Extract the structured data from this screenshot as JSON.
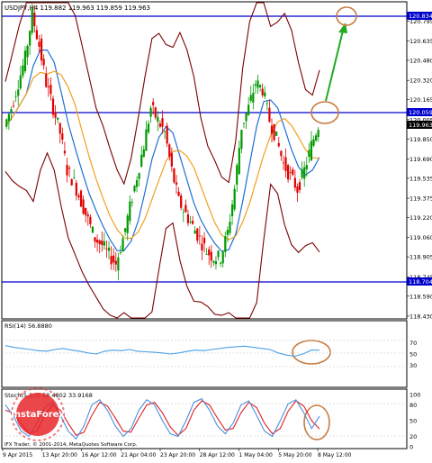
{
  "header": {
    "symbol_line": "USDJPY,H4  119.882 119.963 119.859 119.963"
  },
  "colors": {
    "background": "#ffffff",
    "frame": "#000000",
    "bull_candle": "#009900",
    "bear_candle": "#e00000",
    "bollinger": "#7a0000",
    "ma_blue": "#1f6fd6",
    "ma_orange": "#f0a020",
    "level_line": "#0000cc",
    "arrow": "#22aa22",
    "circle": "#c87a40",
    "rsi_line": "#4aa0e6",
    "stoch_main": "#4a8fe0",
    "stoch_signal": "#e02020",
    "current_price_bg": "#000000",
    "level_price_bg": "#0000cc"
  },
  "price_axis": {
    "ticks": [
      "120.795",
      "120.635",
      "120.480",
      "120.320",
      "120.165",
      "120.005",
      "119.850",
      "119.690",
      "119.535",
      "119.375",
      "119.220",
      "119.060",
      "118.905",
      "118.745",
      "118.590",
      "118.430"
    ],
    "upper_level": "120.834",
    "middle_level": "120.059",
    "current_price": "119.963",
    "lower_level": "118.704"
  },
  "rsi_panel": {
    "label": "RSI(14) 56.8880",
    "ticks": [
      "70",
      "50",
      "30"
    ]
  },
  "stoch_panel": {
    "label": "Stoch(5,3,3) 58.4802 33.9168",
    "ticks": [
      "100",
      "80",
      "50",
      "20",
      "0"
    ]
  },
  "time_axis": {
    "labels": [
      "9 Apr 2015",
      "13 Apr 20:00",
      "16 Apr 12:00",
      "21 Apr 04:00",
      "23 Apr 20:00",
      "28 Apr 12:00",
      "1 May 04:00",
      "5 May 20:00",
      "8 May 12:00"
    ]
  },
  "watermark": {
    "brand": "InstaForex",
    "copyright": "IFX Trader, © 2001-2014, MetaQuotes Software Corp."
  },
  "chart_data": {
    "type": "candlestick",
    "symbol": "USDJPY",
    "timeframe": "H4",
    "ylim": [
      118.43,
      120.9
    ],
    "horizontal_levels": [
      120.834,
      120.059,
      118.704
    ],
    "current_price": 119.963,
    "series": [
      {
        "name": "Price (approx. closes)",
        "values": [
          119.95,
          120.1,
          120.3,
          120.5,
          120.85,
          120.6,
          120.3,
          120.1,
          119.9,
          119.6,
          119.5,
          119.35,
          119.2,
          119.05,
          119.0,
          118.92,
          118.85,
          119.05,
          119.3,
          119.55,
          119.8,
          120.1,
          120.0,
          119.9,
          119.6,
          119.35,
          119.25,
          119.15,
          119.05,
          118.95,
          118.9,
          118.9,
          119.1,
          119.45,
          119.95,
          120.1,
          120.3,
          120.25,
          120.0,
          119.85,
          119.65,
          119.55,
          119.45,
          119.6,
          119.8,
          119.963
        ]
      },
      {
        "name": "RSI(14)",
        "ylim": [
          0,
          100
        ],
        "values": [
          65,
          62,
          60,
          58,
          56,
          55,
          58,
          60,
          57,
          55,
          52,
          50,
          55,
          57,
          56,
          58,
          55,
          54,
          53,
          52,
          50,
          52,
          55,
          57,
          56,
          58,
          60,
          62,
          63,
          64,
          62,
          60,
          58,
          52,
          48,
          46,
          50,
          57,
          56.9
        ]
      },
      {
        "name": "Stoch main",
        "ylim": [
          0,
          100
        ],
        "values": [
          80,
          60,
          30,
          20,
          45,
          75,
          85,
          60,
          30,
          15,
          40,
          80,
          90,
          70,
          40,
          20,
          35,
          70,
          90,
          80,
          50,
          25,
          20,
          50,
          85,
          92,
          70,
          40,
          25,
          45,
          80,
          88,
          60,
          30,
          20,
          50,
          82,
          90,
          65,
          35,
          58.5
        ]
      },
      {
        "name": "Stoch signal",
        "ylim": [
          0,
          100
        ],
        "values": [
          70,
          65,
          45,
          25,
          30,
          60,
          80,
          70,
          45,
          22,
          28,
          60,
          85,
          78,
          55,
          30,
          28,
          55,
          80,
          85,
          65,
          38,
          22,
          35,
          70,
          88,
          80,
          55,
          32,
          35,
          65,
          85,
          75,
          45,
          25,
          35,
          68,
          88,
          78,
          50,
          33.9
        ]
      }
    ],
    "annotations": [
      "Projection arrow toward 120.834 level",
      "Circles marking 120.834 target, 120.059 breakout, RSI and Stochastic readings"
    ]
  }
}
